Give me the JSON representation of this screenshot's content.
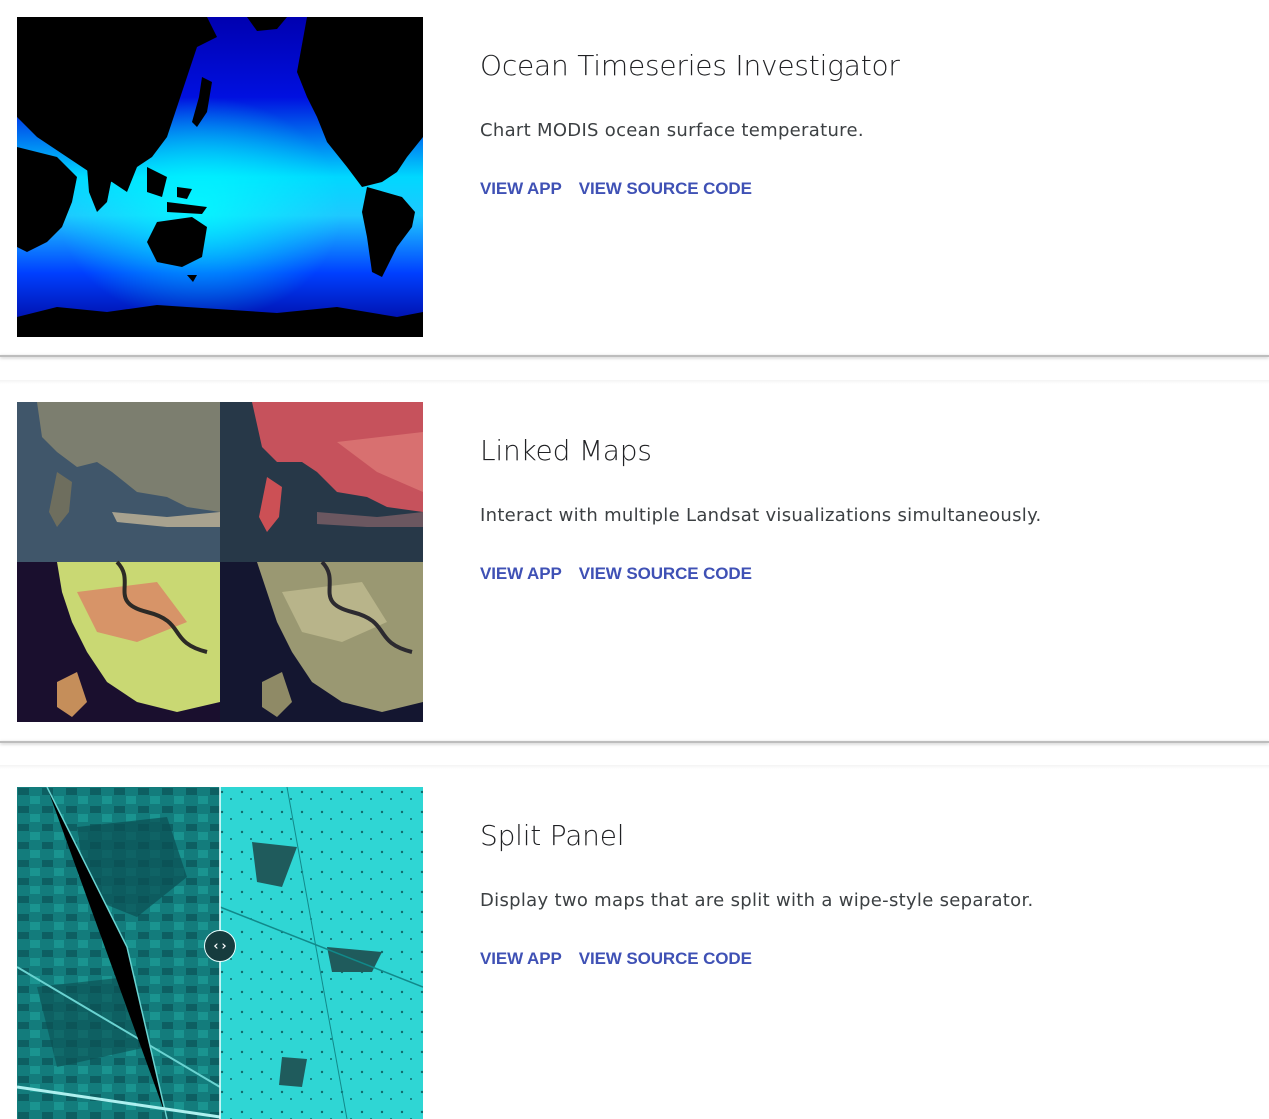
{
  "apps": [
    {
      "title": "Ocean Timeseries Investigator",
      "description": "Chart MODIS ocean surface temperature.",
      "view_app_label": "VIEW APP",
      "view_source_label": "VIEW SOURCE CODE",
      "thumbnail": "ocean-temperature-world-map"
    },
    {
      "title": "Linked Maps",
      "description": "Interact with multiple Landsat visualizations simultaneously.",
      "view_app_label": "VIEW APP",
      "view_source_label": "VIEW SOURCE CODE",
      "thumbnail": "four-panel-landsat-coast"
    },
    {
      "title": "Split Panel",
      "description": "Display two maps that are split with a wipe-style separator.",
      "view_app_label": "VIEW APP",
      "view_source_label": "VIEW SOURCE CODE",
      "thumbnail": "split-panel-cyan-landscape",
      "divider_icon": "chevron-left-right-icon"
    }
  ],
  "colors": {
    "link": "#3f51b5",
    "title": "#202124",
    "description": "#3c4043"
  }
}
